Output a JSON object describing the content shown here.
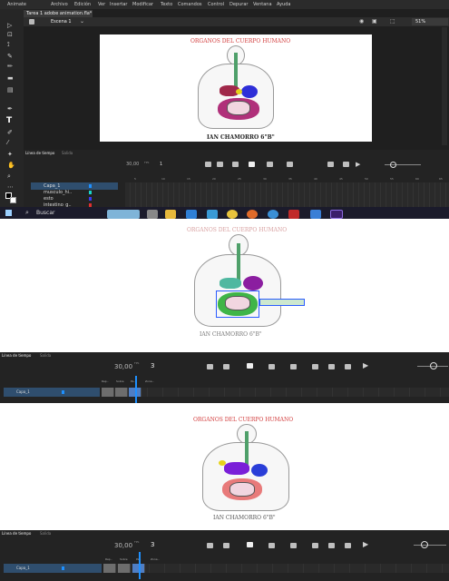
{
  "app": {
    "name": "Animate",
    "menu": [
      "Archivo",
      "Edición",
      "Ver",
      "Insertar",
      "Modificar",
      "Texto",
      "Comandos",
      "Control",
      "Depurar",
      "Ventana",
      "Ayuda"
    ],
    "doc_tab": "Tarea 1 adobe animation.fla*",
    "scene": "Escena 1",
    "zoom": "51%"
  },
  "artwork": {
    "title": "ORGANOS DEL CUERPO HUMANO",
    "signature": "IAN CHAMORRO   6\"B\""
  },
  "timeline_top": {
    "tab_label": "Línea de tiempo",
    "tab2_label": "Salida",
    "fps": "30,00",
    "fps_unit": "FPS",
    "frame": "1",
    "layers": [
      "Capa_1",
      "musculo_hi..",
      "esto",
      "intestino_g.."
    ],
    "frame_numbers": [
      "5",
      "10",
      "15",
      "20",
      "25",
      "30",
      "35",
      "40",
      "45",
      "50",
      "55",
      "60",
      "65"
    ]
  },
  "taskbar": {
    "search": "Buscar"
  },
  "timeline_mid": {
    "tab_label": "Línea de tiempo",
    "tab2_label": "Salida",
    "fps": "30,00",
    "fps_unit": "FPS",
    "frame": "3",
    "layer": "Capa_1",
    "labels": [
      "Rep..",
      "Sobre",
      "Pa..",
      "Zona.."
    ]
  },
  "timeline_bottom": {
    "tab_label": "Línea de tiempo",
    "tab2_label": "Salida",
    "fps": "30,00",
    "fps_unit": "FPS",
    "frame": "3",
    "layer": "Capa_1",
    "labels": [
      "Rep..",
      "Sobre",
      "Pa..",
      "Zona.."
    ]
  },
  "colors": {
    "accent": "#1e90ff",
    "title_red": "#d23c3c"
  }
}
